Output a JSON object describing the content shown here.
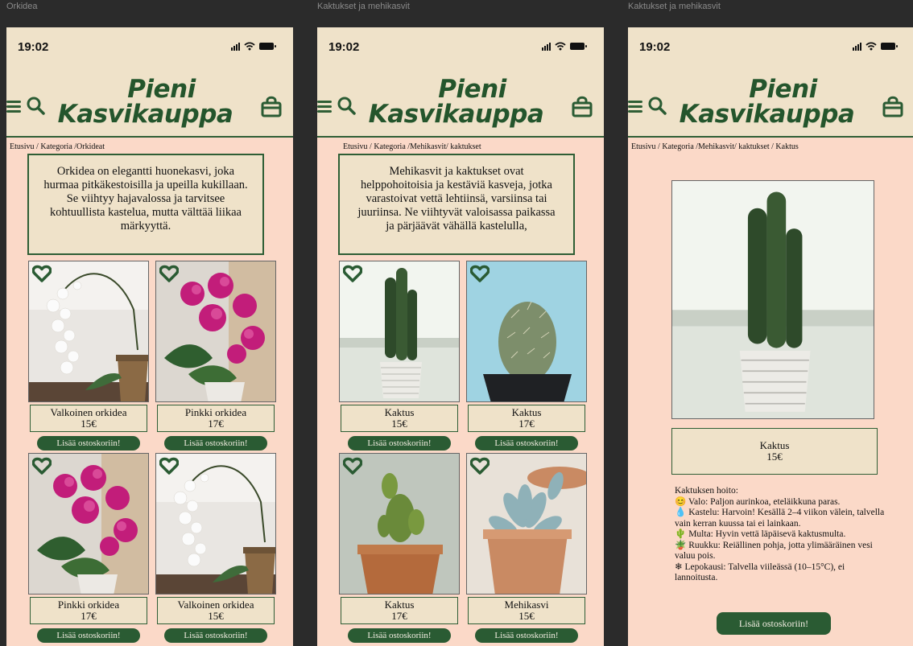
{
  "screens": [
    {
      "frame_title": "Orkidea",
      "time": "19:02",
      "logo": [
        "Pieni",
        "Kasvikauppa"
      ],
      "breadcrumb": "Etusivu / Kategoria /Orkideat",
      "description": "Orkidea on elegantti huonekasvi, joka hurmaa pitkäkestoisilla ja upeilla kukillaan. Se viihtyy hajavalossa ja tarvitsee kohtuullista kastelua, mutta välttää liikaa märkyyttä.",
      "products": [
        {
          "name": "Valkoinen orkidea",
          "price": "15€",
          "button": "Lisää ostoskoriin!",
          "image": "white-orchid"
        },
        {
          "name": "Pinkki orkidea",
          "price": "17€",
          "button": "Lisää ostoskoriin!",
          "image": "pink-orchid"
        },
        {
          "name": "Pinkki orkidea",
          "price": "17€",
          "button": "Lisää ostoskoriin!",
          "image": "pink-orchid"
        },
        {
          "name": "Valkoinen orkidea",
          "price": "15€",
          "button": "Lisää ostoskoriin!",
          "image": "white-orchid"
        }
      ]
    },
    {
      "frame_title": "Kaktukset ja mehikasvit",
      "time": "19:02",
      "logo": [
        "Pieni",
        "Kasvikauppa"
      ],
      "breadcrumb": "Etusivu / Kategoria /Mehikasvit/ kaktukset",
      "description": "Mehikasvit ja kaktukset ovat helppohoitoisia ja kestäviä kasveja, jotka varastoivat vettä lehtiinsä, varsiinsa tai juuriinsa. Ne viihtyvät valoisassa paikassa ja pärjäävät vähällä kastelulla,",
      "products": [
        {
          "name": "Kaktus",
          "price": "15€",
          "button": "Lisää ostoskoriin!",
          "image": "column-cactus"
        },
        {
          "name": "Kaktus",
          "price": "17€",
          "button": "Lisää ostoskoriin!",
          "image": "round-cactus"
        },
        {
          "name": "Kaktus",
          "price": "17€",
          "button": "Lisää ostoskoriin!",
          "image": "paddle-cactus"
        },
        {
          "name": "Mehikasvi",
          "price": "15€",
          "button": "Lisää ostoskoriin!",
          "image": "succulent"
        }
      ]
    },
    {
      "frame_title": "Kaktukset ja mehikasvit",
      "time": "19:02",
      "logo": [
        "Pieni",
        "Kasvikauppa"
      ],
      "breadcrumb": "Etusivu / Kategoria /Mehikasvit/ kaktukset / Kaktus",
      "product": {
        "name": "Kaktus",
        "price": "15€",
        "image": "column-cactus"
      },
      "care": {
        "title": "Kaktuksen hoito:",
        "items": [
          {
            "icon": "sun-icon",
            "emoji": "😊",
            "text": "Valo: Paljon aurinkoa, eteläikkuna paras."
          },
          {
            "icon": "water-drop-icon",
            "emoji": "💧",
            "text": "Kastelu: Harvoin! Kesällä 2–4 viikon välein, talvella vain kerran kuussa tai ei lainkaan."
          },
          {
            "icon": "plant-icon",
            "emoji": "🌵",
            "text": "Multa: Hyvin vettä läpäisevä kaktusmulta."
          },
          {
            "icon": "pot-icon",
            "emoji": "🪴",
            "text": "Ruukku: Reiällinen pohja, jotta ylimääräinen vesi valuu pois."
          },
          {
            "icon": "snowflake-icon",
            "emoji": "❄",
            "text": "Lepokausi: Talvella viileässä (10–15°C), ei lannoitusta."
          }
        ]
      },
      "button": "Lisää ostoskoriin!"
    }
  ],
  "colors": {
    "header_bg": "#efe2c9",
    "page_bg": "#fbd9c8",
    "brand_green": "#2a5b33"
  }
}
